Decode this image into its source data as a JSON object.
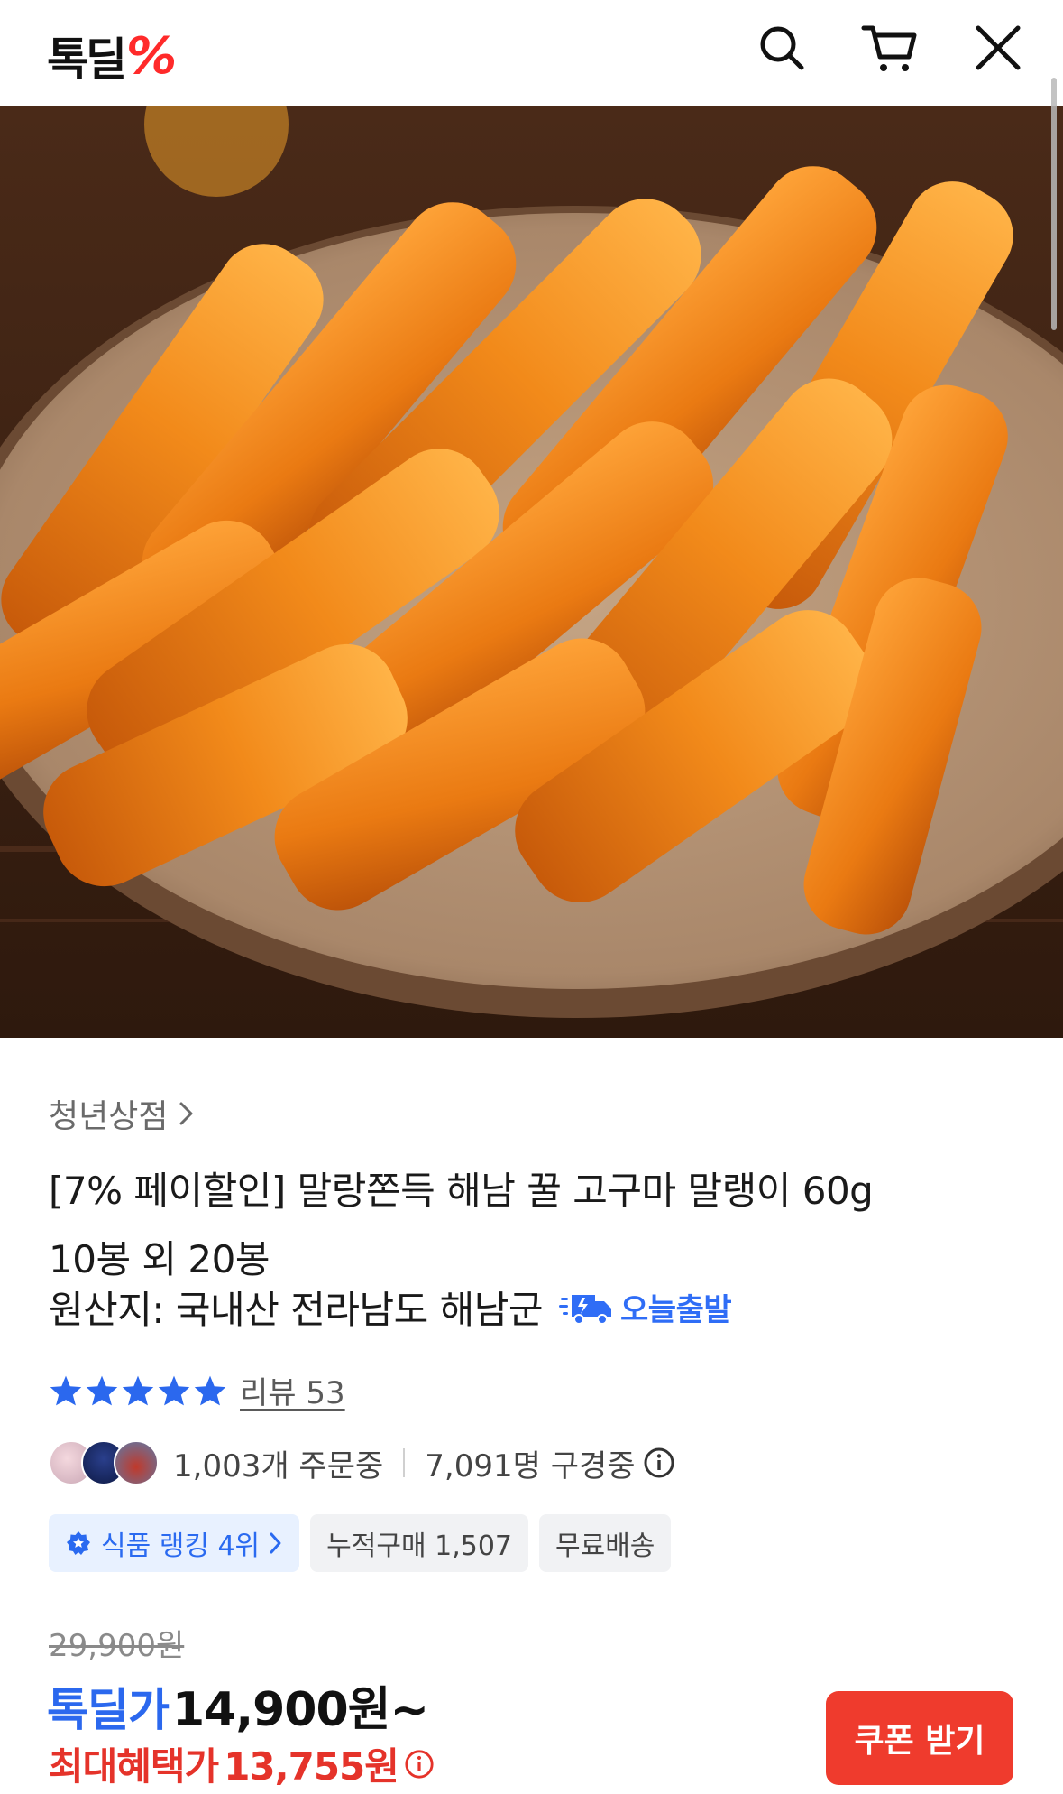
{
  "header": {
    "logo_text": "톡딜",
    "logo_mark": "%",
    "icons": [
      "search-icon",
      "cart-icon",
      "close-icon"
    ]
  },
  "hero": {
    "carousel_dots": 3,
    "active_index": 1
  },
  "product": {
    "seller": "청년상점",
    "title_line1": "[7% 페이할인] 말랑쫀득 해남 꿀 고구마 말랭이 60g",
    "title_line2": "10봉 외 20봉",
    "origin": "원산지: 국내산 전라남도 해남군",
    "today_ship": "오늘출발",
    "review": "리뷰 53",
    "rating_stars": 5,
    "orders": "1,003개 주문중",
    "viewers": "7,091명 구경중",
    "tags": {
      "rank": "식품 랭킹 4위",
      "cumulative": "누적구매 1,507",
      "shipping": "무료배송"
    },
    "original_price": "29,900원",
    "deal_label": "톡딜가",
    "deal_price": "14,900원~",
    "max_label": "최대혜택가",
    "max_price": "13,755원"
  },
  "cta": {
    "coupon": "쿠폰 받기"
  },
  "colors": {
    "accent_blue": "#2b68ee",
    "accent_red": "#ef3b2d",
    "logo_red": "#ff2a2a"
  }
}
